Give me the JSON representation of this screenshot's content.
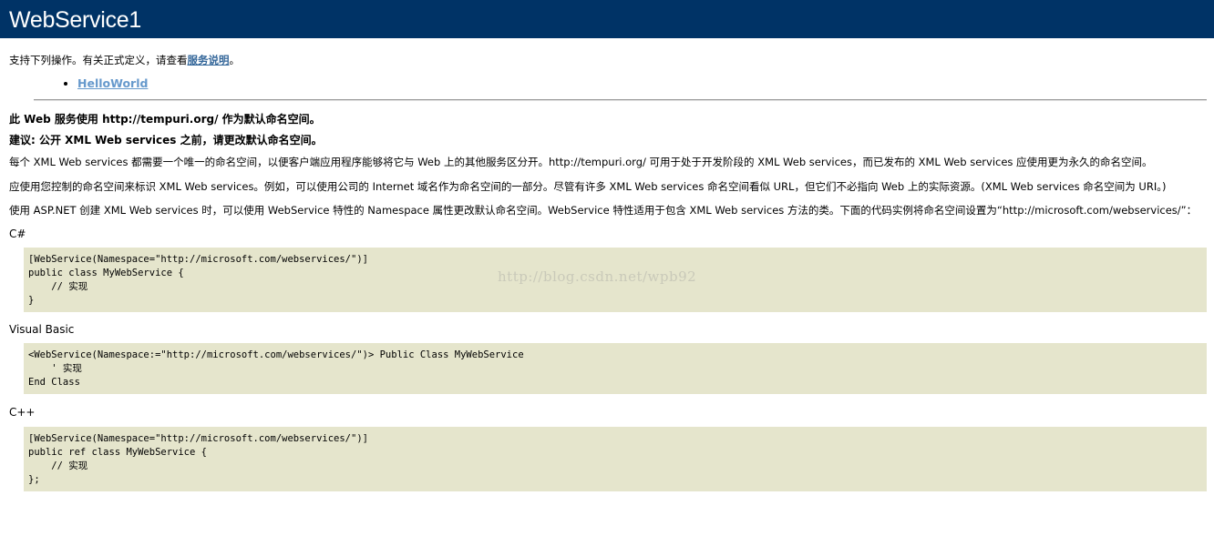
{
  "page": {
    "title": "WebService1",
    "intro_text": "支持下列操作。有关正式定义，请查看",
    "intro_link": "服务说明",
    "intro_end": "。",
    "operations": [
      "HelloWorld"
    ]
  },
  "notice": {
    "line1": "此 Web 服务使用 http://tempuri.org/ 作为默认命名空间。",
    "line2": "建议: 公开 XML Web services 之前，请更改默认命名空间。",
    "para1": "每个 XML Web services 都需要一个唯一的命名空间，以便客户端应用程序能够将它与 Web 上的其他服务区分开。http://tempuri.org/ 可用于处于开发阶段的 XML Web services，而已发布的 XML Web services 应使用更为永久的命名空间。",
    "para2": "应使用您控制的命名空间来标识 XML Web services。例如，可以使用公司的 Internet 域名作为命名空间的一部分。尽管有许多 XML Web services 命名空间看似 URL，但它们不必指向 Web 上的实际资源。(XML Web services 命名空间为 URI。)",
    "para3": "使用 ASP.NET 创建 XML Web services 时，可以使用 WebService 特性的 Namespace 属性更改默认命名空间。WebService 特性适用于包含 XML Web services 方法的类。下面的代码实例将命名空间设置为“http://microsoft.com/webservices/”："
  },
  "examples": {
    "csharp_label": "C#",
    "csharp_code": "[WebService(Namespace=\"http://microsoft.com/webservices/\")]\npublic class MyWebService {\n    // 实现\n}",
    "vb_label": "Visual Basic",
    "vb_code": "<WebService(Namespace:=\"http://microsoft.com/webservices/\")> Public Class MyWebService\n    ' 实现\nEnd Class",
    "cpp_label": "C++",
    "cpp_code": "[WebService(Namespace=\"http://microsoft.com/webservices/\")]\npublic ref class MyWebService {\n    // 实现\n};"
  },
  "watermark": "http://blog.csdn.net/wpb92"
}
